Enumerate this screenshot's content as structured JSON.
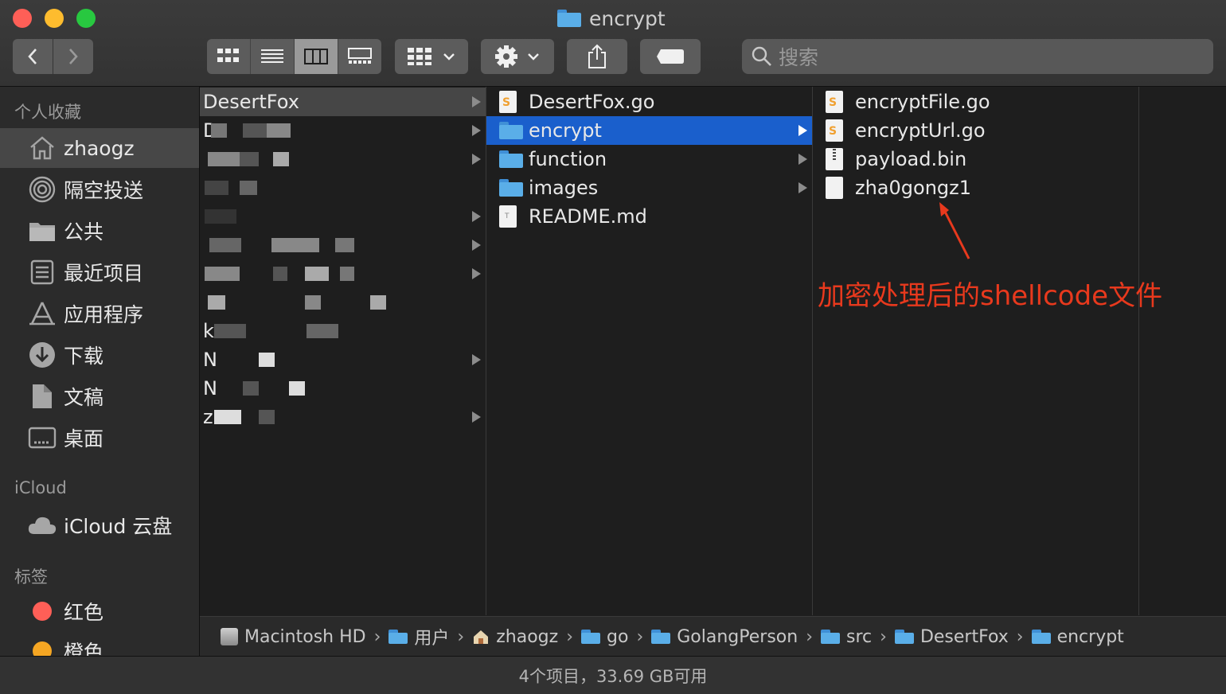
{
  "window": {
    "title": "encrypt"
  },
  "toolbar": {
    "back_icon": "chevron-left-icon",
    "forward_icon": "chevron-right-icon",
    "views": [
      "icon-view",
      "list-view",
      "column-view",
      "gallery-view"
    ],
    "active_view": "column-view",
    "search_placeholder": "搜索"
  },
  "sidebar": {
    "favorites_title": "个人收藏",
    "favorites": [
      {
        "label": "zhaogz",
        "icon": "home-icon",
        "selected": true
      },
      {
        "label": "隔空投送",
        "icon": "airdrop-icon"
      },
      {
        "label": "公共",
        "icon": "folder-icon"
      },
      {
        "label": "最近项目",
        "icon": "recents-icon"
      },
      {
        "label": "应用程序",
        "icon": "applications-icon"
      },
      {
        "label": "下载",
        "icon": "download-icon"
      },
      {
        "label": "文稿",
        "icon": "documents-icon"
      },
      {
        "label": "桌面",
        "icon": "desktop-icon"
      }
    ],
    "icloud_title": "iCloud",
    "icloud": [
      {
        "label": "iCloud 云盘",
        "icon": "cloud-icon"
      }
    ],
    "tags_title": "标签",
    "tags": [
      {
        "label": "红色",
        "color": "#fe5f57"
      },
      {
        "label": "橙色",
        "color": "#f5a623"
      }
    ]
  },
  "columns": {
    "col1": {
      "selected": "DesertFox",
      "visible_prefixes": [
        "D",
        "",
        "",
        "",
        "",
        "",
        "",
        "",
        "k",
        "N",
        "N",
        "z"
      ]
    },
    "col2": {
      "items": [
        {
          "name": "DesertFox.go",
          "type": "go"
        },
        {
          "name": "encrypt",
          "type": "folder",
          "selected": true
        },
        {
          "name": "function",
          "type": "folder"
        },
        {
          "name": "images",
          "type": "folder"
        },
        {
          "name": "README.md",
          "type": "text"
        }
      ]
    },
    "col3": {
      "items": [
        {
          "name": "encryptFile.go",
          "type": "go"
        },
        {
          "name": "encryptUrl.go",
          "type": "go"
        },
        {
          "name": "payload.bin",
          "type": "zip"
        },
        {
          "name": "zha0gongz1",
          "type": "blank"
        }
      ]
    }
  },
  "annotation": {
    "text": "加密处理后的shellcode文件",
    "color": "#e8391d"
  },
  "pathbar": [
    {
      "label": "Macintosh HD",
      "icon": "hard-drive-icon"
    },
    {
      "label": "用户",
      "icon": "users-folder-icon"
    },
    {
      "label": "zhaogz",
      "icon": "home-icon"
    },
    {
      "label": "go",
      "icon": "folder-icon"
    },
    {
      "label": "GolangPerson",
      "icon": "folder-icon"
    },
    {
      "label": "src",
      "icon": "folder-icon"
    },
    {
      "label": "DesertFox",
      "icon": "folder-icon"
    },
    {
      "label": "encrypt",
      "icon": "folder-icon"
    }
  ],
  "status": {
    "text": "4个项目，33.69 GB可用"
  }
}
